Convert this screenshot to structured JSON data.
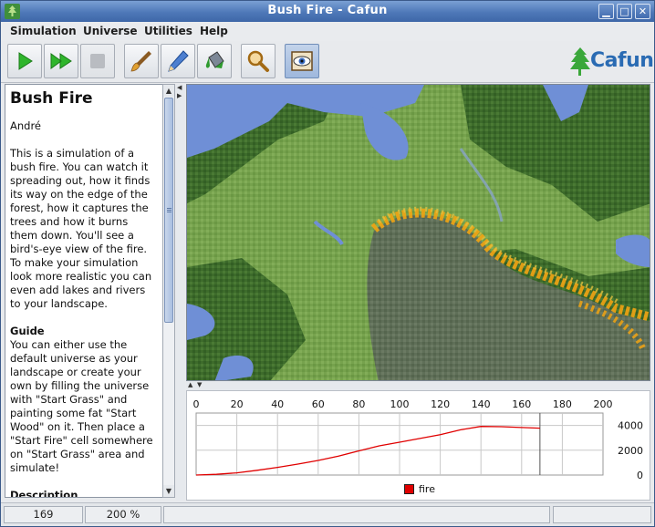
{
  "window": {
    "title": "Bush Fire - Cafun",
    "minimize": "▁",
    "maximize": "□",
    "close": "✕"
  },
  "menu": [
    "Simulation",
    "Universe",
    "Utilities",
    "Help"
  ],
  "toolbar": {
    "buttons": [
      "play-icon",
      "fast-forward-icon",
      "stop-icon",
      "paintbrush-icon",
      "pencil-icon",
      "paint-bucket-icon",
      "magnifier-icon",
      "eye-view-icon"
    ],
    "logo_text": "Cafun"
  },
  "document": {
    "title": "Bush Fire",
    "author": "André",
    "intro": "This is a simulation of a bush fire. You can watch it spreading out, how it finds its way on the edge of the forest, how it captures the trees and how it burns them down. You'll see a bird's-eye view of the fire. To make your simulation look more realistic you can even add lakes and rivers to your landscape.",
    "guide_heading": "Guide",
    "guide": "You can either use the default universe as your landscape or create your own by filling the universe with \"Start Grass\" and painting some fat \"Start Wood\" on it. Then place a \"Start Fire\" cell somewhere on \"Start Grass\" area and simulate!",
    "description_heading": "Description"
  },
  "chart_data": {
    "type": "line",
    "x_ticks": [
      "0",
      "20",
      "40",
      "60",
      "80",
      "100",
      "120",
      "140",
      "160",
      "180",
      "200"
    ],
    "y_ticks": [
      "4000",
      "2000",
      "0"
    ],
    "xlim": [
      0,
      200
    ],
    "ylim": [
      0,
      5000
    ],
    "grid": true,
    "legend_position": "bottom",
    "marker_x": 169,
    "series": [
      {
        "name": "fire",
        "color": "#e00000",
        "x": [
          0,
          10,
          20,
          30,
          40,
          50,
          60,
          70,
          80,
          90,
          100,
          110,
          120,
          130,
          140,
          150,
          160,
          169
        ],
        "y": [
          0,
          60,
          180,
          380,
          620,
          880,
          1180,
          1520,
          1950,
          2350,
          2650,
          2950,
          3250,
          3650,
          3920,
          3900,
          3830,
          3780
        ]
      }
    ]
  },
  "status": {
    "step": "169",
    "zoom": "200 %"
  },
  "colors": {
    "fire": "#e00000",
    "water": "#7090d8",
    "forest": "#3f6b2a",
    "grass": "#7aa650",
    "burnt": "#5b6b56"
  }
}
